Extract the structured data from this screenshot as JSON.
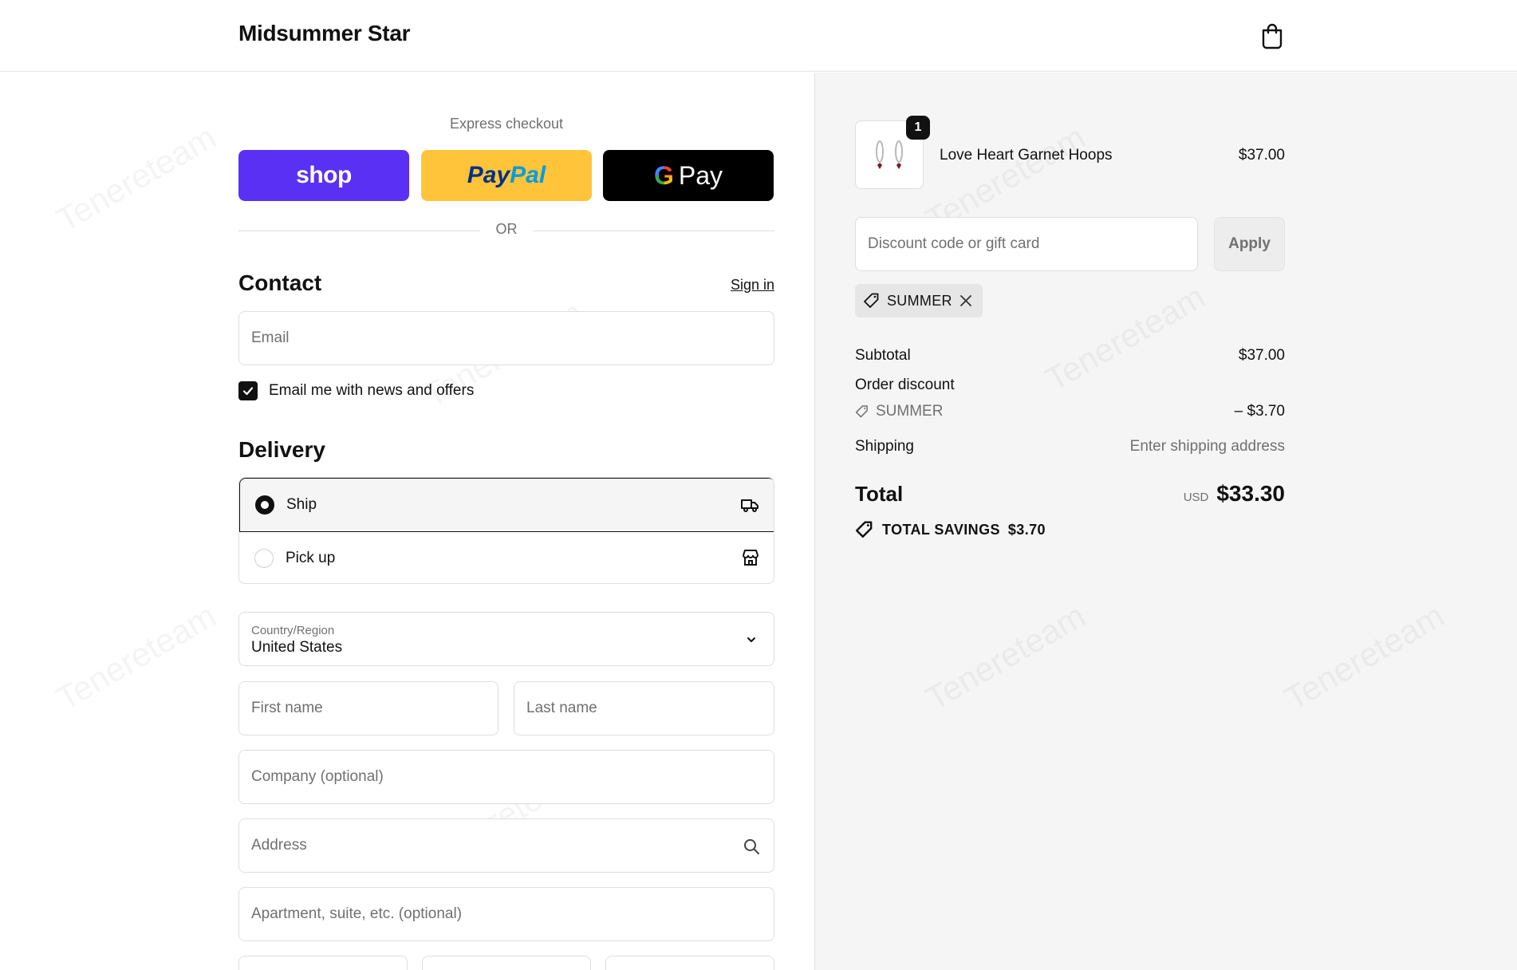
{
  "header": {
    "brand": "Midsummer Star",
    "cart_icon": "shopping-bag-icon"
  },
  "express": {
    "label": "Express checkout",
    "shop_pay_label": "shop",
    "paypal_part1": "Pay",
    "paypal_part2": "Pal",
    "gpay_g": "G",
    "gpay_label": "Pay",
    "or_label": "OR"
  },
  "contact": {
    "title": "Contact",
    "sign_in": "Sign in",
    "email_placeholder": "Email",
    "newsletter_label": "Email me with news and offers",
    "newsletter_checked": true
  },
  "delivery": {
    "title": "Delivery",
    "options": [
      {
        "label": "Ship",
        "selected": true,
        "icon": "truck-icon"
      },
      {
        "label": "Pick up",
        "selected": false,
        "icon": "store-icon"
      }
    ],
    "country_label": "Country/Region",
    "country_value": "United States",
    "first_name_placeholder": "First name",
    "last_name_placeholder": "Last name",
    "company_placeholder": "Company (optional)",
    "address_placeholder": "Address",
    "apartment_placeholder": "Apartment, suite, etc. (optional)"
  },
  "summary": {
    "item": {
      "quantity": "1",
      "name": "Love Heart Garnet Hoops",
      "price": "$37.00"
    },
    "discount_placeholder": "Discount code or gift card",
    "apply_label": "Apply",
    "applied_code": "SUMMER",
    "subtotal_label": "Subtotal",
    "subtotal_value": "$37.00",
    "order_discount_label": "Order discount",
    "order_discount_code": "SUMMER",
    "order_discount_value": "– $3.70",
    "shipping_label": "Shipping",
    "shipping_value": "Enter shipping address",
    "total_label": "Total",
    "total_currency": "USD",
    "total_value": "$33.30",
    "savings_label": "TOTAL SAVINGS",
    "savings_value": "$3.70"
  },
  "colors": {
    "shop_pay": "#5a31f4",
    "paypal": "#ffc439",
    "gpay": "#000000",
    "summary_bg": "#f5f5f5"
  }
}
